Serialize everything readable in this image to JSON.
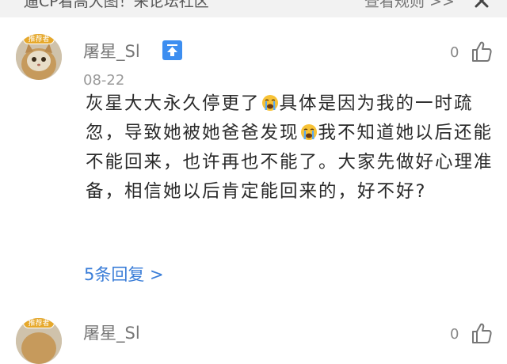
{
  "top_bar": {
    "notice": "遛CP看高大图！来论坛社区",
    "rules": "查看规则 >>",
    "close_icon": "close-icon"
  },
  "comments": [
    {
      "badge": "推荐者",
      "username": "屠星_Sl",
      "level_icon": "up-arrow-badge-icon",
      "likes": "0",
      "date": "08-22",
      "text_parts": [
        "灰星大大永久停更了",
        "具体是因为我的一时疏忽，导致她被她爸爸发现",
        "我不知道她以后还能不能回来，也许再也不能了。大家先做好心理准备，相信她以后肯定能回来的，好不好?"
      ],
      "emoji": "crying-face-icon",
      "replies": "5条回复 >"
    },
    {
      "badge": "推荐者",
      "username": "屠星_Sl",
      "likes": "0"
    }
  ]
}
